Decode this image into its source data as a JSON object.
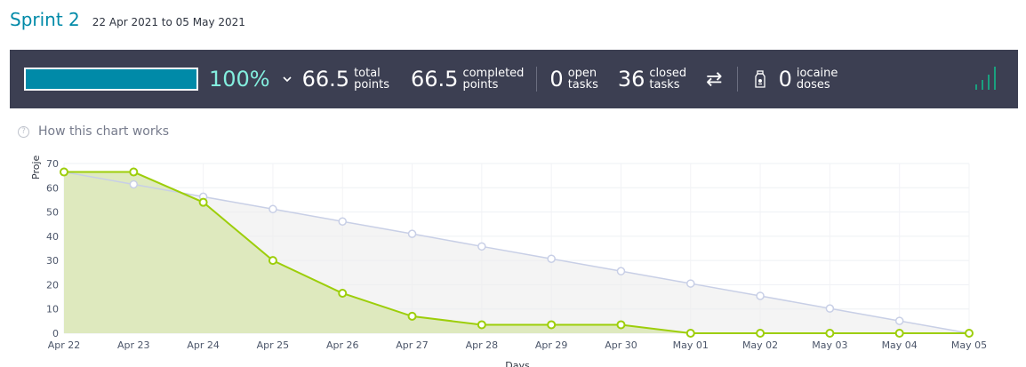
{
  "header": {
    "title": "Sprint 2",
    "dates": "22 Apr 2021 to 05 May 2021"
  },
  "stats": {
    "progress_percent": "100%",
    "progress_fraction": 1.0,
    "total_points": {
      "value": "66.5",
      "label1": "total",
      "label2": "points"
    },
    "completed_points": {
      "value": "66.5",
      "label1": "completed",
      "label2": "points"
    },
    "open_tasks": {
      "value": "0",
      "label1": "open",
      "label2": "tasks"
    },
    "closed_tasks": {
      "value": "36",
      "label1": "closed",
      "label2": "tasks"
    },
    "iocaine": {
      "value": "0",
      "label1": "iocaine",
      "label2": "doses"
    }
  },
  "help": {
    "label": "How this chart works"
  },
  "colors": {
    "accent": "#008aa8",
    "percent": "#83eede",
    "bar_bg": "#3c3f52",
    "real": "#9dce0a",
    "optimal": "#c8cfe6"
  },
  "chart_data": {
    "type": "area",
    "title": "",
    "xlabel": "Days",
    "ylabel": "Proje",
    "categories": [
      "Apr 22",
      "Apr 23",
      "Apr 24",
      "Apr 25",
      "Apr 26",
      "Apr 27",
      "Apr 28",
      "Apr 29",
      "Apr 30",
      "May 01",
      "May 02",
      "May 03",
      "May 04",
      "May 05"
    ],
    "ylim": [
      0,
      70
    ],
    "yticks": [
      0,
      10,
      20,
      30,
      40,
      50,
      60,
      70
    ],
    "grid": true,
    "series": [
      {
        "values": [
          66.5,
          61.4,
          56.3,
          51.2,
          46.1,
          41.0,
          35.8,
          30.7,
          25.6,
          20.5,
          15.4,
          10.2,
          5.1,
          0
        ]
      },
      {
        "values": [
          66.5,
          66.5,
          54.0,
          30.0,
          16.5,
          7.0,
          3.5,
          3.5,
          3.5,
          0,
          0,
          0,
          0,
          0
        ]
      }
    ]
  }
}
